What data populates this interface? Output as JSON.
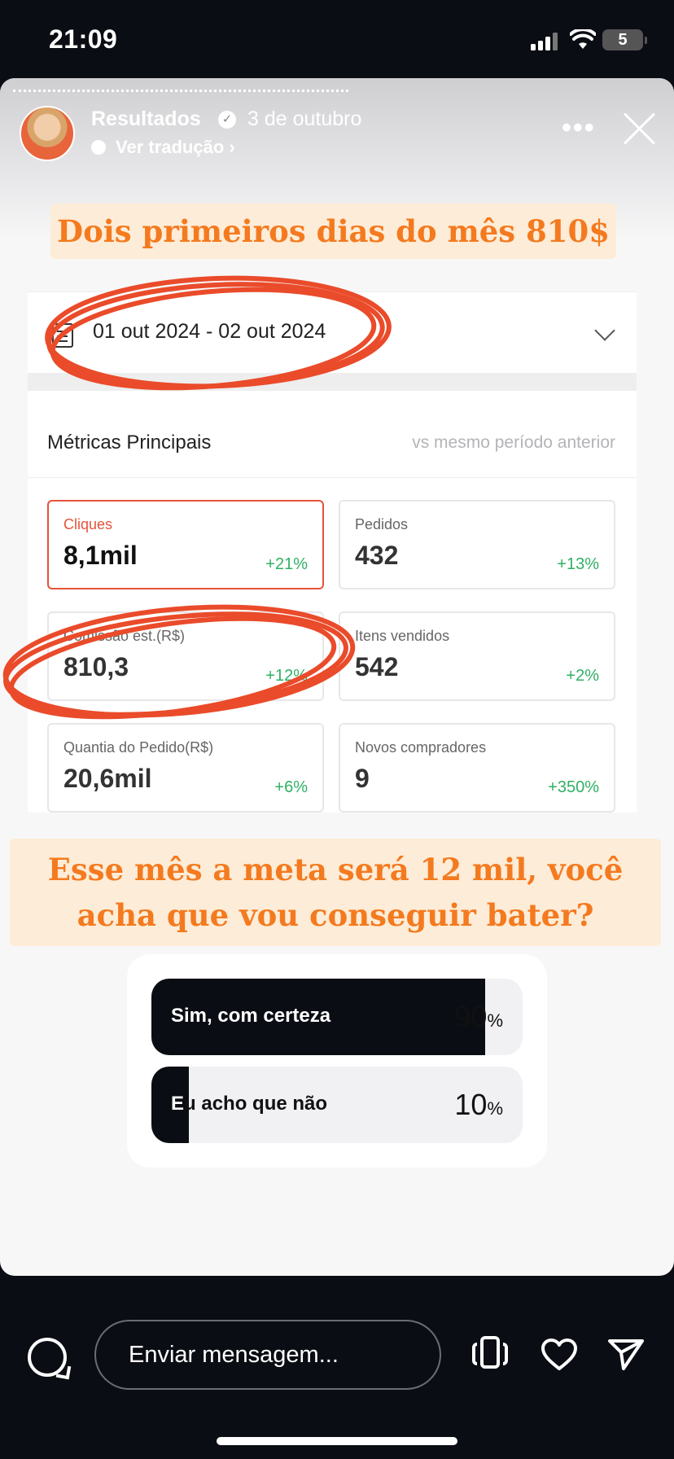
{
  "status_bar": {
    "time": "21:09",
    "battery": "5"
  },
  "story": {
    "author": "Resultados",
    "date": "3 de outubro",
    "translate_label": "Ver tradução",
    "headline_top": "Dois primeiros dias do mês 810$",
    "headline_bottom": [
      "Esse mês a meta será 12 mil, você",
      "acha que vou conseguir bater?"
    ]
  },
  "screenshot_card": {
    "date_range": "01 out 2024 - 02 out 2024",
    "metrics_title": "Métricas Principais",
    "metrics_compare": "vs mesmo período anterior",
    "tiles": [
      {
        "label": "Cliques",
        "value": "8,1mil",
        "change": "+21%"
      },
      {
        "label": "Pedidos",
        "value": "432",
        "change": "+13%"
      },
      {
        "label": "Comissão est.(R$)",
        "value": "810,3",
        "change": "+12%"
      },
      {
        "label": "Itens vendidos",
        "value": "542",
        "change": "+2%"
      },
      {
        "label": "Quantia do Pedido(R$)",
        "value": "20,6mil",
        "change": "+6%"
      },
      {
        "label": "Novos compradores",
        "value": "9",
        "change": "+350%"
      }
    ]
  },
  "poll": {
    "options": [
      {
        "label": "Sim, com certeza",
        "percent": "90",
        "share": 0.9
      },
      {
        "label_dark": "E",
        "label_rest": "u acho que não",
        "percent": "10",
        "share": 0.1
      }
    ],
    "percent_sign": "%"
  },
  "bottom_bar": {
    "message_placeholder": "Enviar mensagem..."
  },
  "colors": {
    "accent_orange": "#f47a1f",
    "highlight_bg": "#fdecd7",
    "scribble_red": "#ea4b2a",
    "positive_green": "#2fb064"
  }
}
